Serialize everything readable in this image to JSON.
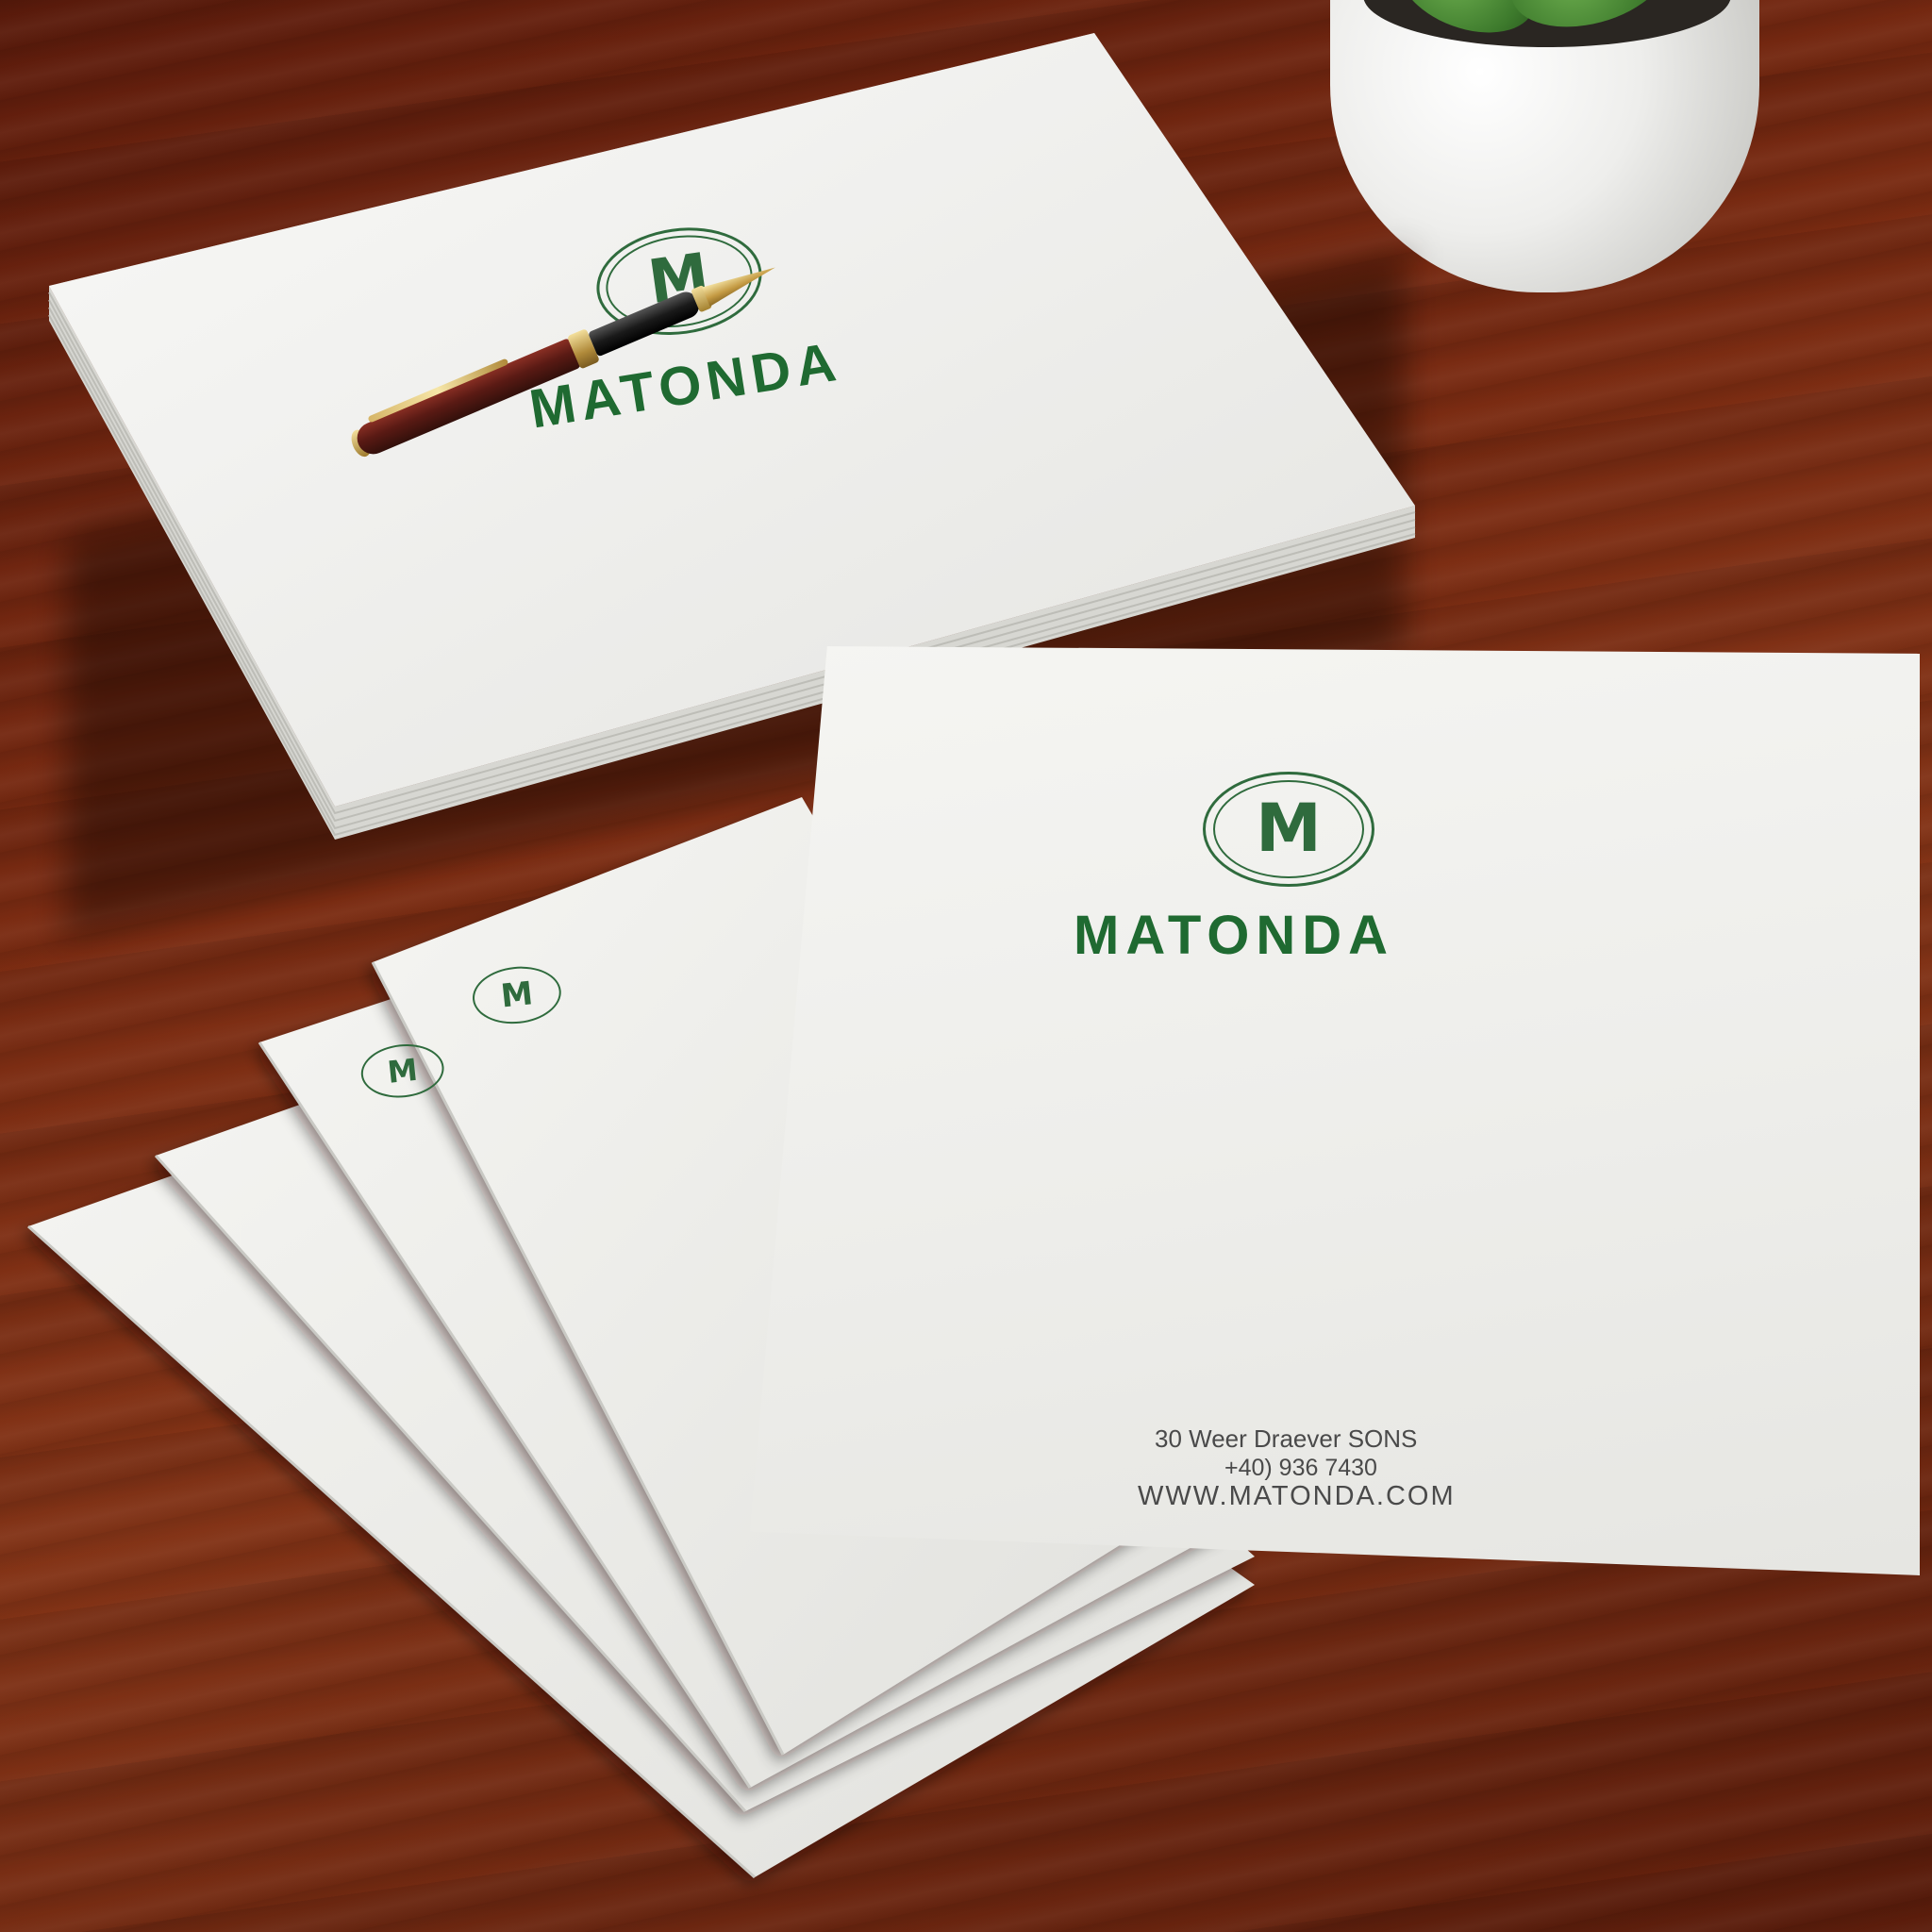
{
  "scene": {
    "description_kind": "product-mockup photo",
    "colors": {
      "brand_green": "#1f6a31",
      "desk": "#7a2b12",
      "paper": "#f1f1ee"
    }
  },
  "stack": {
    "monogram": "M",
    "brand": "MATONDA"
  },
  "front_sheet": {
    "monogram": "M",
    "brand": "MATONDA",
    "address_line": "30 Weer Draever SONS",
    "phone_line": "+40) 936 7430",
    "website_line": "WWW.MATONDA.COM"
  },
  "fan_sheets": {
    "monogram_a": "M",
    "monogram_b": "M"
  },
  "icons": [
    "fountain-pen-icon",
    "plant-pot-icon",
    "monogram-logo-icon"
  ]
}
